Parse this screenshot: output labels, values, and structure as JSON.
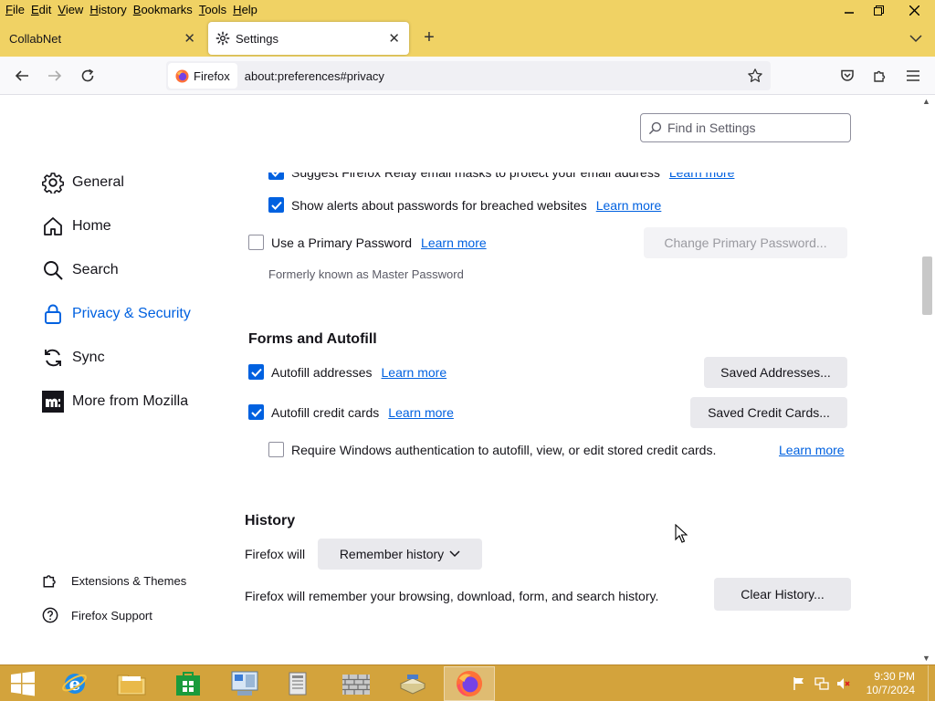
{
  "menu": [
    {
      "key": "F",
      "rest": "ile"
    },
    {
      "key": "E",
      "rest": "dit"
    },
    {
      "key": "V",
      "rest": "iew"
    },
    {
      "key": "H",
      "rest": "istory"
    },
    {
      "key": "B",
      "rest": "ookmarks"
    },
    {
      "key": "T",
      "rest": "ools"
    },
    {
      "key": "H",
      "rest": "elp"
    }
  ],
  "tabs": {
    "inactive_label": "CollabNet",
    "active_label": "Settings"
  },
  "urlbar": {
    "identity_label": "Firefox",
    "url": "about:preferences#privacy"
  },
  "search": {
    "placeholder": "Find in Settings"
  },
  "sidebar": {
    "items": [
      {
        "label": "General",
        "icon": "gear-icon"
      },
      {
        "label": "Home",
        "icon": "home-icon"
      },
      {
        "label": "Search",
        "icon": "search-icon"
      },
      {
        "label": "Privacy & Security",
        "icon": "lock-icon"
      },
      {
        "label": "Sync",
        "icon": "sync-icon"
      },
      {
        "label": "More from Mozilla",
        "icon": "mozilla-icon"
      }
    ],
    "footer": [
      {
        "label": "Extensions & Themes",
        "icon": "puzzle-icon"
      },
      {
        "label": "Firefox Support",
        "icon": "help-icon"
      }
    ]
  },
  "passwords": {
    "relay_label": "Suggest Firefox Relay email masks to protect your email address",
    "breach_label": "Show alerts about passwords for breached websites",
    "primary_label": "Use a Primary Password",
    "primary_note": "Formerly known as Master Password",
    "change_primary_button": "Change Primary Password...",
    "learn_more": "Learn more"
  },
  "forms": {
    "heading": "Forms and Autofill",
    "addresses_label": "Autofill addresses",
    "cards_label": "Autofill credit cards",
    "winauth_label": "Require Windows authentication to autofill, view, or edit stored credit cards.",
    "saved_addresses_button": "Saved Addresses...",
    "saved_cards_button": "Saved Credit Cards..."
  },
  "history": {
    "heading": "History",
    "firefox_will": "Firefox will",
    "mode_value": "Remember history",
    "description": "Firefox will remember your browsing, download, form, and search history.",
    "clear_button": "Clear History..."
  },
  "clock": {
    "time": "9:30 PM",
    "date": "10/7/2024"
  },
  "colors": {
    "accent": "#0061e0",
    "titlebar": "#f0d264",
    "taskbar": "#d3a33c"
  }
}
